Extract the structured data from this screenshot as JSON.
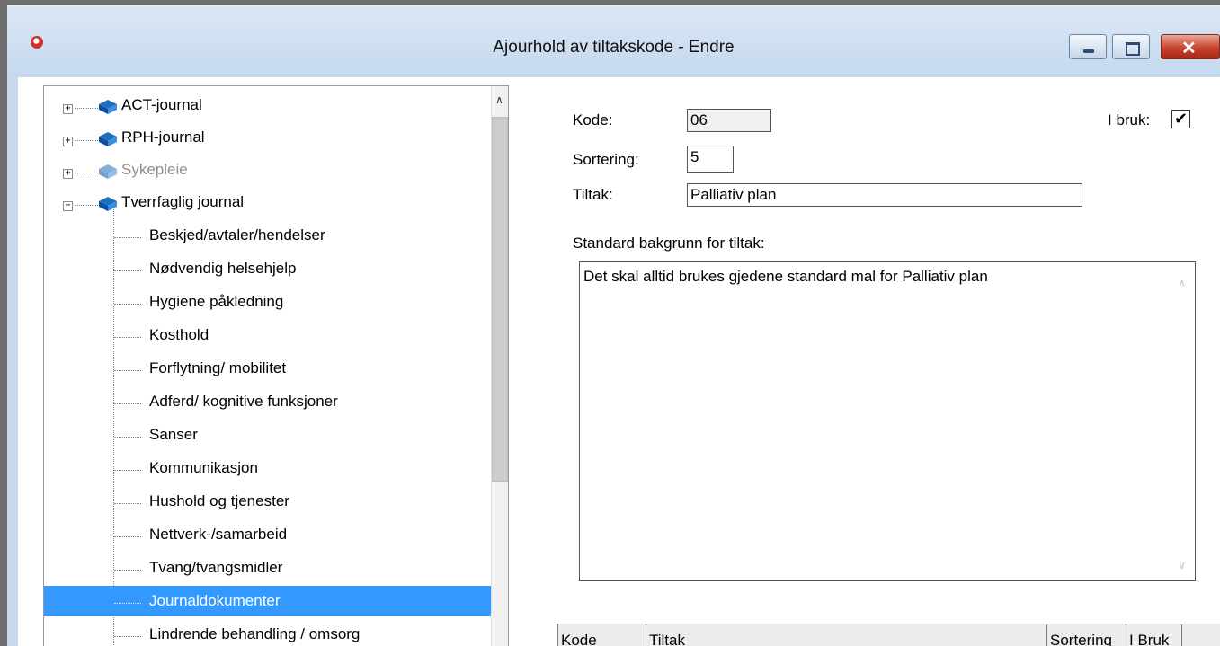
{
  "window": {
    "title": "Ajourhold av tiltakskode - Endre",
    "close_glyph": "✕"
  },
  "tree": {
    "nodes": [
      {
        "label": "ACT-journal",
        "expander": "+"
      },
      {
        "label": "RPH-journal",
        "expander": "+"
      },
      {
        "label": "Sykepleie",
        "expander": "+"
      },
      {
        "label": "Tverrfaglig journal",
        "expander": "−"
      }
    ],
    "leaves": [
      "Beskjed/avtaler/hendelser",
      "Nødvendig helsehjelp",
      "Hygiene påkledning",
      "Kosthold",
      "Forflytning/ mobilitet",
      "Adferd/ kognitive funksjoner",
      "Sanser",
      "Kommunikasjon",
      "Hushold og tjenester",
      "Nettverk-/samarbeid",
      "Tvang/tvangsmidler",
      "Journaldokumenter",
      "Lindrende behandling / omsorg"
    ],
    "selected": "Journaldokumenter"
  },
  "form": {
    "kode_label": "Kode:",
    "kode_value": "06",
    "sortering_label": "Sortering:",
    "sortering_value": "5",
    "tiltak_label": "Tiltak:",
    "tiltak_value": "Palliativ plan",
    "i_bruk_label": "I bruk:",
    "i_bruk_checked": true,
    "i_bruk_mark": "✔",
    "bakgrunn_label": "Standard bakgrunn for tiltak:",
    "bakgrunn_value": "Det skal alltid brukes gjedene standard mal for Palliativ plan"
  },
  "grid": {
    "columns": [
      "Kode",
      "Tiltak",
      "Sortering",
      "I Bruk"
    ]
  },
  "colors": {
    "titlebar": "#c5d8ee",
    "selection": "#3399ff",
    "close_button": "#c8432e",
    "book_icon": "#1e6fc2"
  }
}
